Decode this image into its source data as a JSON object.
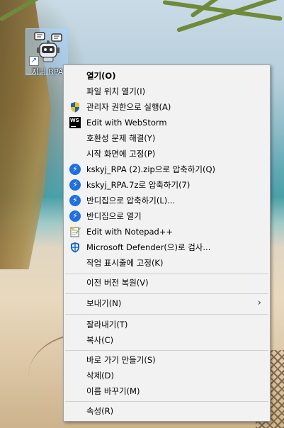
{
  "desktop": {
    "icon_label": "지니 RPA",
    "icon_name": "robot-chat-icon"
  },
  "menu": {
    "items": [
      {
        "label": "열기(O)",
        "bold": true,
        "icon": ""
      },
      {
        "label": "파일 위치 열기(I)",
        "icon": ""
      },
      {
        "label": "관리자 권한으로 실행(A)",
        "icon": "uac-shield-icon"
      },
      {
        "label": "Edit with WebStorm",
        "icon": "webstorm-icon"
      },
      {
        "label": "호환성 문제 해결(Y)",
        "icon": ""
      },
      {
        "label": "시작 화면에 고정(P)",
        "icon": ""
      },
      {
        "label": "kskyj_RPA (2).zip으로 압축하기(Q)",
        "icon": "bandizip-icon"
      },
      {
        "label": "kskyj_RPA.7z로 압축하기(7)",
        "icon": "bandizip-icon"
      },
      {
        "label": "반디집으로 압축하기(L)...",
        "icon": "bandizip-icon"
      },
      {
        "label": "반디집으로 열기",
        "icon": "bandizip-icon"
      },
      {
        "label": "Edit with Notepad++",
        "icon": "notepadpp-icon"
      },
      {
        "label": "Microsoft Defender(으)로 검사...",
        "icon": "defender-icon"
      },
      {
        "label": "작업 표시줄에 고정(K)",
        "icon": ""
      },
      {
        "label": "이전 버전 복원(V)",
        "icon": ""
      },
      {
        "label": "보내기(N)",
        "icon": "",
        "submenu": true
      },
      {
        "label": "잘라내기(T)",
        "icon": ""
      },
      {
        "label": "복사(C)",
        "icon": ""
      },
      {
        "label": "바로 가기 만들기(S)",
        "icon": ""
      },
      {
        "label": "삭제(D)",
        "icon": ""
      },
      {
        "label": "이름 바꾸기(M)",
        "icon": ""
      },
      {
        "label": "속성(R)",
        "icon": ""
      }
    ],
    "submenu_chevron": "›"
  },
  "colors": {
    "menu_bg": "#f2f2f2",
    "bandizip_blue": "#1e6fe0",
    "defender_blue": "#1565c0"
  }
}
